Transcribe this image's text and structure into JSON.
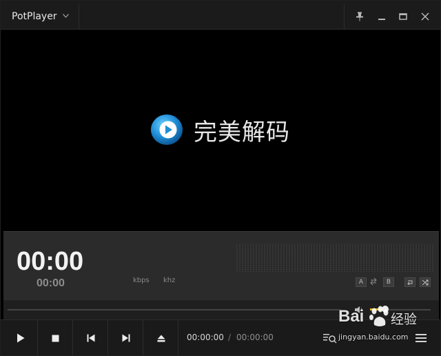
{
  "titlebar": {
    "app_name": "PotPlayer",
    "menu_chevron": "chevron-down-icon",
    "controls": [
      "pin-icon",
      "minimize-icon",
      "maximize-icon",
      "close-icon"
    ]
  },
  "video": {
    "logo_text": "完美解码",
    "logo_icon": "play-logo-icon",
    "accent_color": "#2a9fe0"
  },
  "info": {
    "time_main": "00:00",
    "time_sub": "00:00",
    "kbps_label": "kbps",
    "khz_label": "khz",
    "mini_buttons": [
      "A",
      "B"
    ]
  },
  "seek": {
    "position": 0,
    "volume": 0.25,
    "volume_color": "#e2b51a"
  },
  "controls": {
    "current_time": "00:00:00",
    "separator": "/",
    "total_time": "00:00:00",
    "buttons": [
      "play-icon",
      "stop-icon",
      "prev-icon",
      "next-icon",
      "eject-icon"
    ]
  },
  "watermark": {
    "brand": "Bai",
    "brand_suffix": "经验",
    "url": "jingyan.baidu.com"
  }
}
